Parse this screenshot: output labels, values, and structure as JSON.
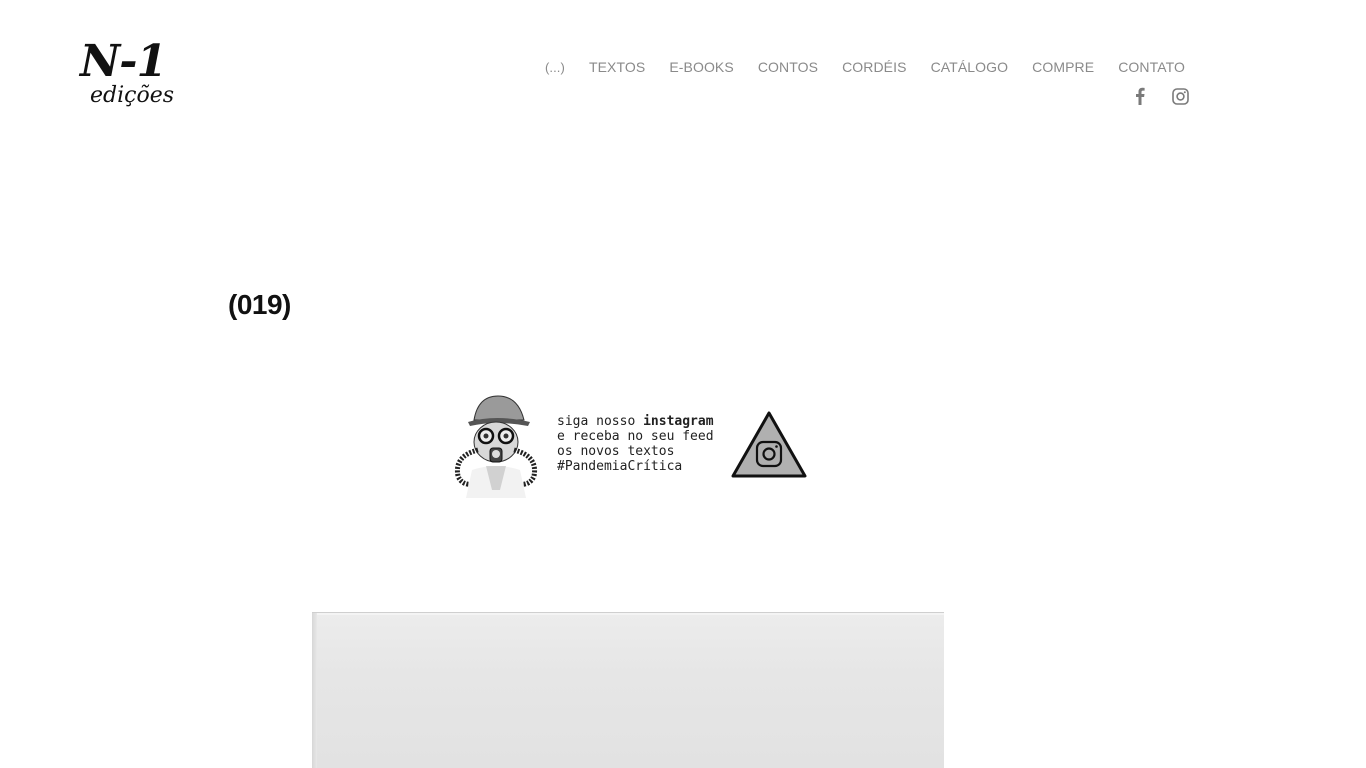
{
  "brand": {
    "logo_top": "N-1",
    "logo_bottom": "edições"
  },
  "nav": {
    "items": [
      {
        "label": "(...)"
      },
      {
        "label": "TEXTOS"
      },
      {
        "label": "E-BOOKS"
      },
      {
        "label": "CONTOS"
      },
      {
        "label": "CORDÉIS"
      },
      {
        "label": "CATÁLOGO"
      },
      {
        "label": "COMPRE"
      },
      {
        "label": "CONTATO"
      }
    ],
    "social": [
      {
        "icon": "facebook-icon"
      },
      {
        "icon": "instagram-icon"
      }
    ]
  },
  "post": {
    "title": "(019)"
  },
  "banner": {
    "line1_prefix": "siga nosso ",
    "line1_bold": "instagram",
    "line2": "e receba no seu feed",
    "line3": "os novos textos",
    "line4": "#PandemiaCrítica"
  },
  "colors": {
    "nav_text": "#8a8a8a",
    "title_text": "#111111",
    "background": "#ffffff"
  }
}
